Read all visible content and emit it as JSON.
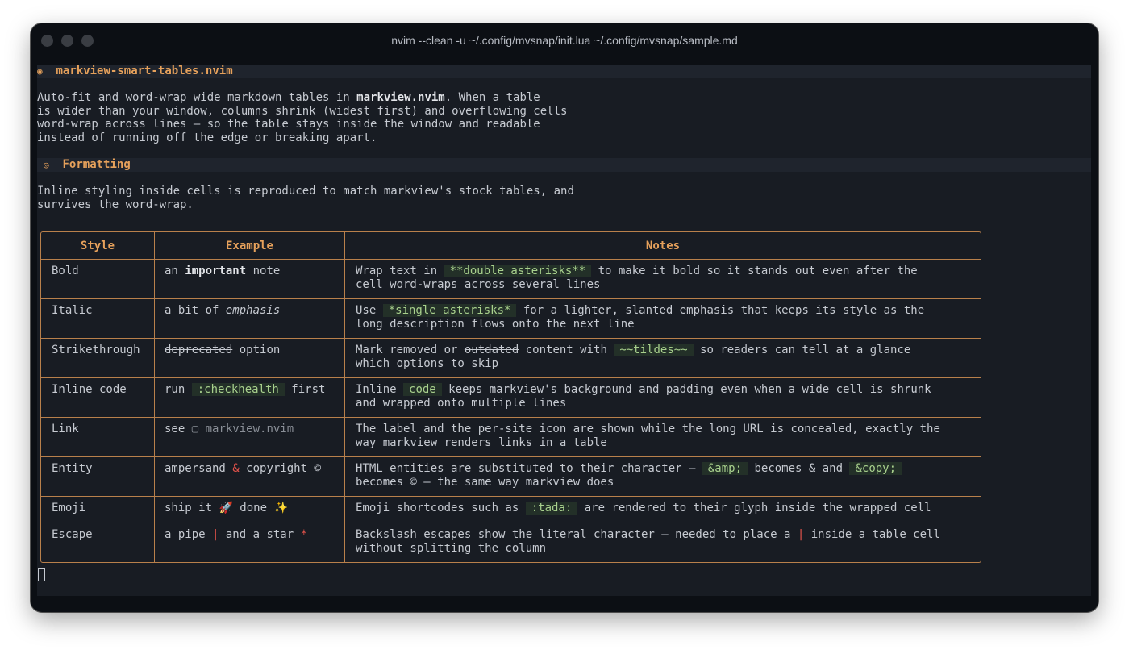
{
  "window": {
    "title": "nvim --clean -u ~/.config/mvsnap/init.lua ~/.config/mvsnap/sample.md"
  },
  "doc": {
    "heading1": {
      "icon": "◉",
      "text": "markview-smart-tables.nvim"
    },
    "para1": {
      "line1_pre": "Auto-fit and word-wrap wide markdown tables in ",
      "line1_bold": "markview.nvim",
      "line1_post": ". When a table",
      "line2": "is wider than your window, columns shrink (widest first) and overflowing cells",
      "line3": "word-wrap across lines — so the table stays inside the window and readable",
      "line4": "instead of running off the edge or breaking apart."
    },
    "heading2": {
      "icon": "◎",
      "text": "Formatting"
    },
    "para2": {
      "line1": "Inline styling inside cells is reproduced to match markview's stock tables, and",
      "line2": "survives the word-wrap."
    }
  },
  "table": {
    "headers": [
      "Style",
      "Example",
      "Notes"
    ],
    "bold": {
      "style": "Bold",
      "ex_pre": "an ",
      "ex_bold": "important",
      "ex_post": " note",
      "n1_pre": "Wrap text in ",
      "n1_code": "**double asterisks**",
      "n1_post": " to make it bold so it stands out even after the",
      "n2": "cell word-wraps across several lines"
    },
    "italic": {
      "style": "Italic",
      "ex_pre": "a bit of ",
      "ex_em": "emphasis",
      "n1_pre": "Use ",
      "n1_code": "*single asterisks*",
      "n1_post": " for a lighter, slanted emphasis that keeps its style as the",
      "n2": "long description flows onto the next line"
    },
    "strike": {
      "style": "Strikethrough",
      "ex_strike": "deprecated",
      "ex_post": " option",
      "n1_pre": "Mark removed or ",
      "n1_strike": "outdated",
      "n1_mid": " content with ",
      "n1_code": "~~tildes~~",
      "n1_post": " so readers can tell at a glance",
      "n2": "which options to skip"
    },
    "code": {
      "style": "Inline code",
      "ex_pre": "run ",
      "ex_code": ":checkhealth",
      "ex_post": " first",
      "n1_pre": "Inline ",
      "n1_code": "code",
      "n1_post": " keeps markview's background and padding even when a wide cell is shrunk",
      "n2": "and wrapped onto multiple lines"
    },
    "link": {
      "style": "Link",
      "ex_pre": "see ",
      "ex_icon": "▢",
      "ex_link": "markview.nvim",
      "n1": "The label and the per-site icon are shown while the long URL is concealed, exactly the",
      "n2": "way markview renders links in a table"
    },
    "entity": {
      "style": "Entity",
      "ex_pre": "ampersand ",
      "ex_amp": "&",
      "ex_post": " copyright ©",
      "n1_pre": "HTML entities are substituted to their character — ",
      "n1_code1": "&amp;",
      "n1_mid": " becomes & and ",
      "n1_code2": "&copy;",
      "n2": "becomes © — the same way markview does"
    },
    "emoji": {
      "style": "Emoji",
      "ex_pre": "ship it ",
      "ex_e1": "🚀",
      "ex_mid": " done ",
      "ex_e2": "✨",
      "n1_pre": "Emoji shortcodes such as ",
      "n1_code": ":tada:",
      "n1_post": " are rendered to their glyph inside the wrapped cell"
    },
    "escape": {
      "style": "Escape",
      "ex_pre": "a pipe ",
      "ex_pipe": "|",
      "ex_mid": " and a star ",
      "ex_star": "*",
      "n1_pre": "Backslash escapes show the literal character — needed to place a ",
      "n1_pipe": "|",
      "n1_post": " inside a table cell",
      "n2": "without splitting the column"
    }
  }
}
